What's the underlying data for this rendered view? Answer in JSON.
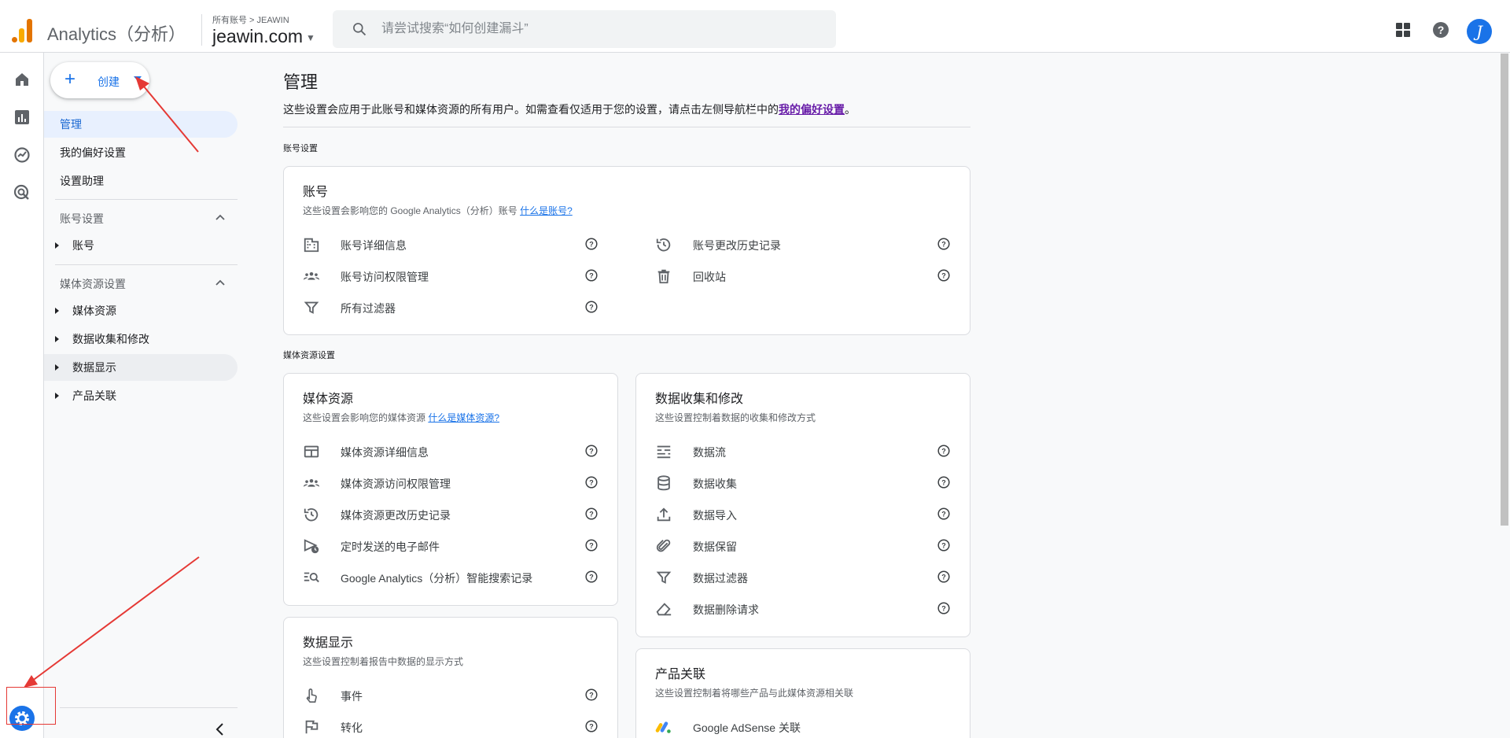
{
  "header": {
    "app_title": "Analytics（分析）",
    "breadcrumb": "所有账号 > JEAWIN",
    "property": "jeawin.com",
    "search_placeholder": "请尝试搜索“如何创建漏斗”",
    "avatar_letter": "J"
  },
  "sidebar": {
    "create_label": "创建",
    "items": [
      {
        "label": "管理"
      },
      {
        "label": "我的偏好设置"
      },
      {
        "label": "设置助理"
      }
    ],
    "account_section": "账号设置",
    "account_items": [
      {
        "label": "账号"
      }
    ],
    "property_section": "媒体资源设置",
    "property_items": [
      {
        "label": "媒体资源"
      },
      {
        "label": "数据收集和修改"
      },
      {
        "label": "数据显示"
      },
      {
        "label": "产品关联"
      }
    ]
  },
  "main": {
    "title": "管理",
    "description": "这些设置会应用于此账号和媒体资源的所有用户。如需查看仅适用于您的设置，请点击左侧导航栏中的",
    "description_link": "我的偏好设置",
    "description_end": "。",
    "account_group_label": "账号设置",
    "property_group_label": "媒体资源设置",
    "account_card": {
      "title": "账号",
      "desc": "这些设置会影响您的 Google Analytics（分析）账号",
      "desc_link": "什么是账号?",
      "left_rows": [
        {
          "label": "账号详细信息",
          "icon": "building-icon"
        },
        {
          "label": "账号访问权限管理",
          "icon": "people-icon"
        },
        {
          "label": "所有过滤器",
          "icon": "filter-icon"
        }
      ],
      "right_rows": [
        {
          "label": "账号更改历史记录",
          "icon": "history-icon"
        },
        {
          "label": "回收站",
          "icon": "trash-icon"
        }
      ]
    },
    "property_card": {
      "title": "媒体资源",
      "desc": "这些设置会影响您的媒体资源",
      "desc_link": "什么是媒体资源?",
      "rows": [
        {
          "label": "媒体资源详细信息",
          "icon": "property-details-icon"
        },
        {
          "label": "媒体资源访问权限管理",
          "icon": "people-icon"
        },
        {
          "label": "媒体资源更改历史记录",
          "icon": "history-icon"
        },
        {
          "label": "定时发送的电子邮件",
          "icon": "scheduled-email-icon"
        },
        {
          "label": "Google Analytics（分析）智能搜索记录",
          "icon": "search-history-icon"
        }
      ]
    },
    "data_card": {
      "title": "数据收集和修改",
      "desc": "这些设置控制着数据的收集和修改方式",
      "rows": [
        {
          "label": "数据流",
          "icon": "data-streams-icon"
        },
        {
          "label": "数据收集",
          "icon": "database-icon"
        },
        {
          "label": "数据导入",
          "icon": "upload-icon"
        },
        {
          "label": "数据保留",
          "icon": "paperclip-icon"
        },
        {
          "label": "数据过滤器",
          "icon": "filter-icon"
        },
        {
          "label": "数据删除请求",
          "icon": "eraser-icon"
        }
      ]
    },
    "display_card": {
      "title": "数据显示",
      "desc": "这些设置控制着报告中数据的显示方式",
      "rows": [
        {
          "label": "事件",
          "icon": "touch-icon"
        },
        {
          "label": "转化",
          "icon": "flag-icon"
        }
      ]
    },
    "links_card": {
      "title": "产品关联",
      "desc": "这些设置控制着将哪些产品与此媒体资源相关联",
      "rows": [
        {
          "label": "Google AdSense 关联",
          "icon": "adsense-icon"
        }
      ]
    }
  },
  "colors": {
    "accent": "#1a73e8",
    "annotation": "#e53935",
    "analytics_orange": "#f9ab00",
    "analytics_dark_orange": "#e37400"
  }
}
